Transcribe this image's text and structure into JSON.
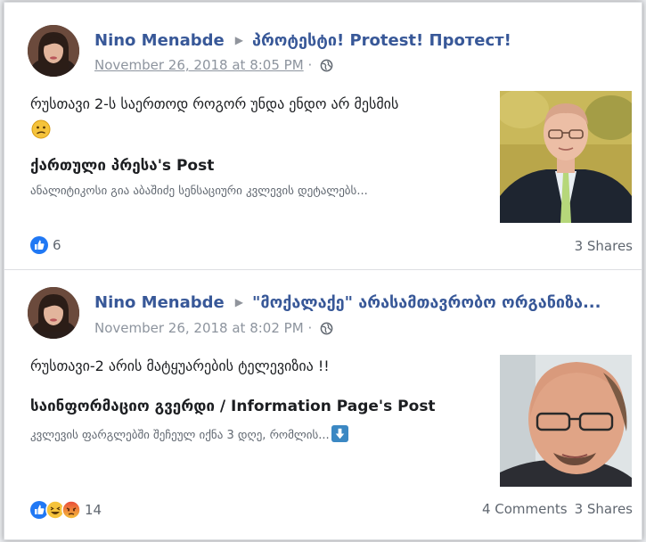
{
  "posts": [
    {
      "author": "Nino Menabde",
      "target": "პროტესტი! Protest! Протест!",
      "timestamp": "November 26, 2018 at 8:05 PM",
      "privacy_icon": "globe-icon",
      "body": "რუსთავი 2-ს საერთოდ როგორ უნდა ენდო არ მესმის",
      "emoji": "confused-face-emoji",
      "shared_title": "ქართული პრესა's Post",
      "shared_desc": "ანალიტიკოსი გია აბაშიძე სენსაციური კვლევის დეტალებს...",
      "reaction_count": "6",
      "reaction_icons": [
        "like-icon"
      ],
      "comments": "",
      "shares": "3 Shares"
    },
    {
      "author": "Nino Menabde",
      "target": "\"მოქალაქე\" არასამთავრობო ორგანიზა...",
      "timestamp": "November 26, 2018 at 8:02 PM",
      "privacy_icon": "globe-icon",
      "body": "რუსთავი-2 არის მატყუარების ტელევიზია !!",
      "shared_title": "საინფორმაციო გვერდი / Information Page's Post",
      "shared_desc": "კვლევის ფარგლებში შეჩეულ იქნა 3 დღე, რომლის...",
      "desc_icon": "down-arrow-icon",
      "reaction_count": "14",
      "reaction_icons": [
        "like-icon",
        "haha-icon",
        "angry-icon"
      ],
      "comments": "4 Comments",
      "shares": "3 Shares"
    }
  ],
  "colors": {
    "link": "#385898",
    "meta": "#8d949e",
    "like": "#2078f4",
    "emoji_yellow": "#f5c33b",
    "angry": "#e9710f"
  }
}
